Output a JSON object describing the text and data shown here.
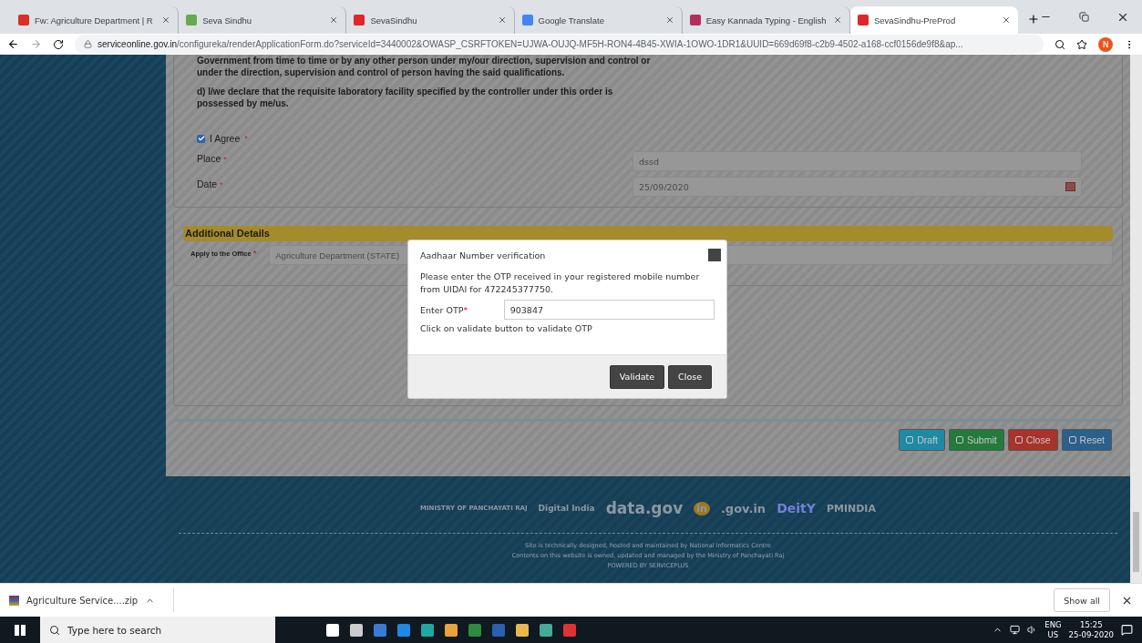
{
  "browser": {
    "tabs": [
      {
        "title": "Fw: Agriculture Department | R",
        "color": "#d93025",
        "selected": false
      },
      {
        "title": "Seva Sindhu",
        "color": "#6aa84f",
        "selected": false
      },
      {
        "title": "SevaSindhu",
        "color": "#e0262b",
        "selected": false
      },
      {
        "title": "Google Translate",
        "color": "#4285f4",
        "selected": false
      },
      {
        "title": "Easy Kannada Typing - English",
        "color": "#b0305a",
        "selected": false
      },
      {
        "title": "SevaSindhu-PreProd",
        "color": "#e0262b",
        "selected": true
      }
    ],
    "url_host": "serviceonline.gov.in",
    "url_path": "/configureka/renderApplicationForm.do?serviceId=3440002&OWASP_CSRFTOKEN=UJWA-OUJQ-MF5H-RON4-4B45-XWIA-1OWO-1DR1&UUID=669d69f8-c2b9-4502-a168-ccf0156de9f8&ap...",
    "profile": "N"
  },
  "form": {
    "declaration": [
      "Government from time to time or by any other person under my/our direction, supervision and control or under the direction, supervision and control of person having the said qualifications.",
      "d)  I/we declare that the requisite laboratory facility specified by the controller under this order is possessed by me/us."
    ],
    "required": "*",
    "agree": {
      "label": "I Agree",
      "checked": true
    },
    "fields": [
      {
        "label": "Place",
        "value": "dssd",
        "kind": "text"
      },
      {
        "label": "Date",
        "value": "25/09/2020",
        "kind": "date"
      }
    ],
    "additional": {
      "title": "Additional Details",
      "office_label": "Apply to the Office",
      "office_value": "Agriculture Department (STATE)"
    },
    "actions": [
      {
        "label": "Draft",
        "color": "#1f8aa3"
      },
      {
        "label": "Submit",
        "color": "#237a3b"
      },
      {
        "label": "Close",
        "color": "#a8322c"
      },
      {
        "label": "Reset",
        "color": "#2b5f8c"
      }
    ]
  },
  "modal": {
    "title": "Aadhaar Number verification",
    "message": "Please enter the OTP received in your registered mobile number from UIDAI for 472245377750.",
    "otp_label": "Enter OTP",
    "otp_value": "903847",
    "hint": "Click on validate button to validate OTP",
    "buttons": [
      "Validate",
      "Close"
    ]
  },
  "footer": {
    "logos": [
      "MINISTRY OF PANCHAYATI RAJ",
      "Digital India",
      "data.gov",
      "in",
      ".gov.in",
      "DeitY",
      "PMINDIA"
    ],
    "credits": [
      "Site is technically designed, hosted and maintained by National Informatics Centre",
      "Contents on this website is owned, updated and managed by the Ministry of Panchayati Raj",
      "POWERED BY SERVICEPLUS"
    ]
  },
  "downloads": {
    "file": "Agriculture Service....zip",
    "show_all": "Show all"
  },
  "taskbar": {
    "search": "Type here to search",
    "lang": "ENG",
    "region": "US",
    "time": "15:25",
    "date": "25-09-2020"
  }
}
